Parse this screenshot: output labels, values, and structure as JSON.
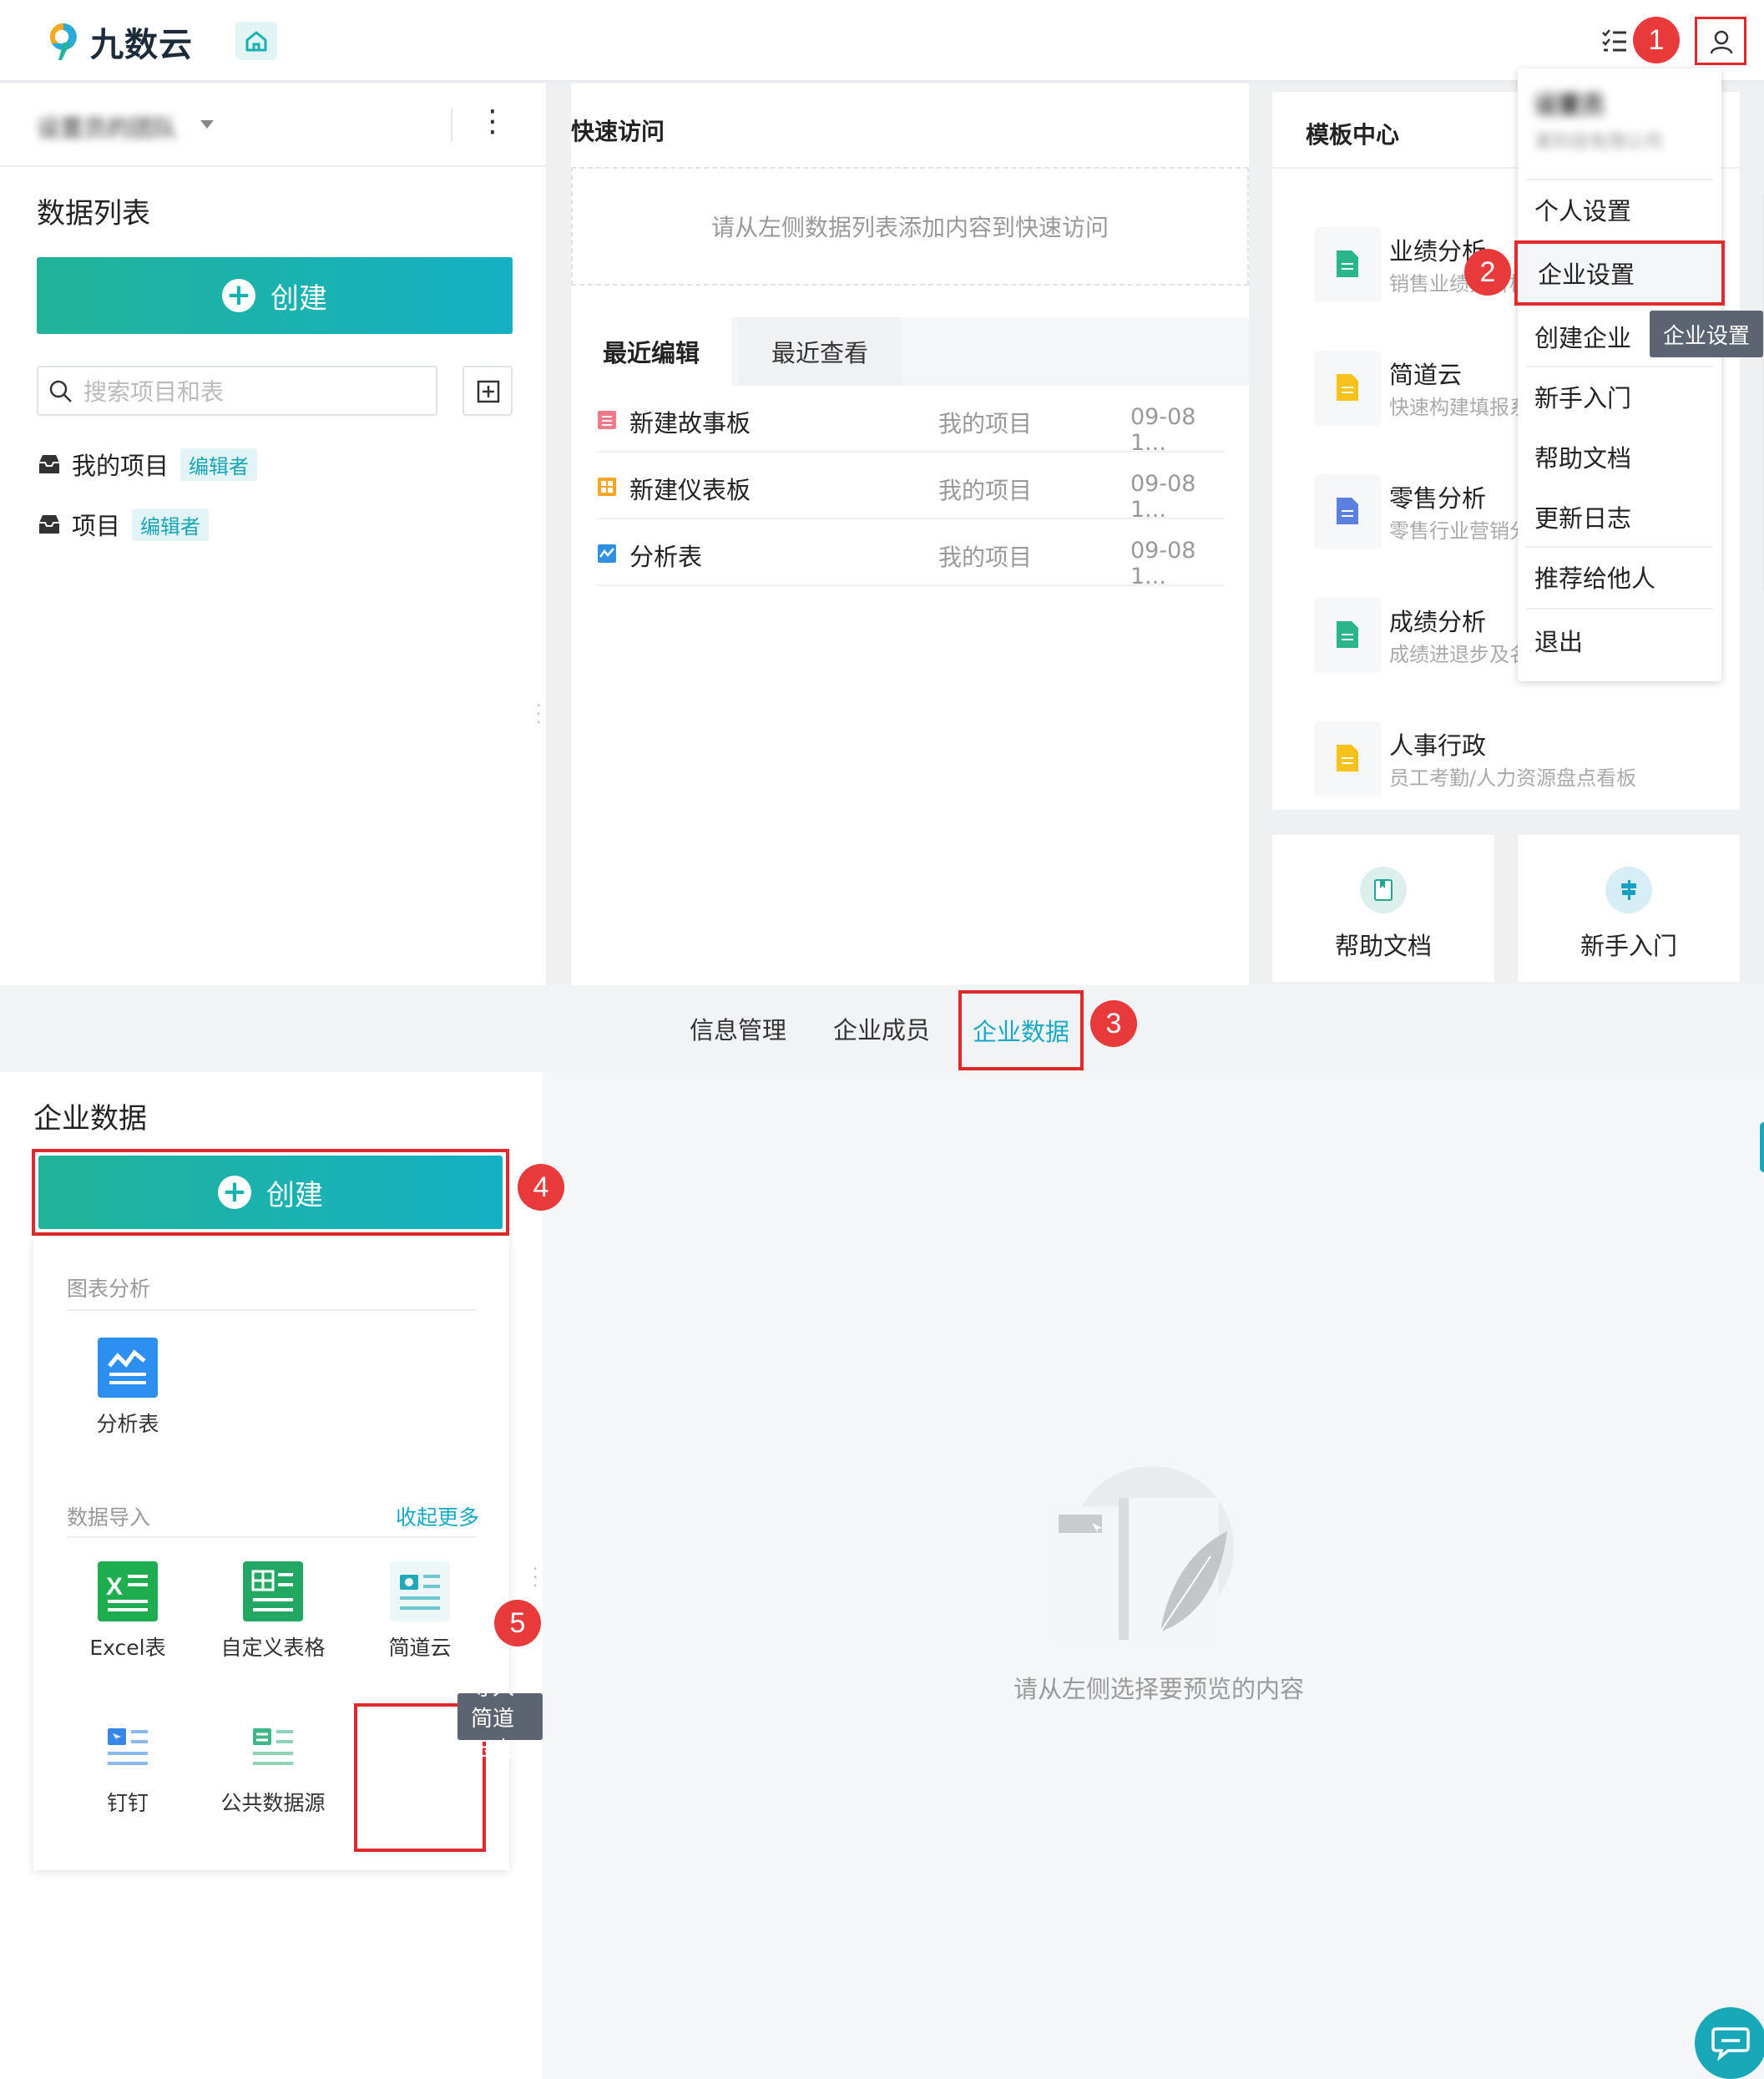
{
  "app": {
    "logo_text": "九数云",
    "brand_color": "#17b1b0",
    "annotation_color": "#e0292c"
  },
  "steps": [
    "1",
    "2",
    "3",
    "4",
    "5"
  ],
  "header": {
    "home_icon": "home-icon",
    "tasks_icon": "task-list-icon",
    "user_icon": "user-icon"
  },
  "left_panel": {
    "team_name": "设置员的团队",
    "title": "数据列表",
    "create_label": "创建",
    "search_placeholder": "搜索项目和表",
    "projects": [
      {
        "name": "我的项目",
        "tag": "编辑者"
      },
      {
        "name": "项目",
        "tag": "编辑者"
      }
    ]
  },
  "quick_access": {
    "title": "快速访问",
    "empty_hint": "请从左侧数据列表添加内容到快速访问"
  },
  "recent": {
    "tabs": [
      "最近编辑",
      "最近查看"
    ],
    "rows": [
      {
        "name": "新建故事板",
        "project": "我的项目",
        "date": "09-08 1..."
      },
      {
        "name": "新建仪表板",
        "project": "我的项目",
        "date": "09-08 1..."
      },
      {
        "name": "分析表",
        "project": "我的项目",
        "date": "09-08 1..."
      }
    ]
  },
  "template_center": {
    "title": "模板中心",
    "items": [
      {
        "name": "业绩分析",
        "desc": "销售业绩分析模板"
      },
      {
        "name": "简道云",
        "desc": "快速构建填报系统"
      },
      {
        "name": "零售分析",
        "desc": "零售行业营销分析"
      },
      {
        "name": "成绩分析",
        "desc": "成绩进退步及名次"
      },
      {
        "name": "人事行政",
        "desc": "员工考勤/人力资源盘点看板"
      }
    ],
    "shortcuts": [
      "帮助文档",
      "新手入门"
    ]
  },
  "user_menu": {
    "user_name": "设置员",
    "company": "某科技有限公司",
    "items": [
      "个人设置",
      "企业设置",
      "创建企业",
      "新手入门",
      "帮助文档",
      "更新日志",
      "推荐给他人",
      "退出"
    ],
    "tooltip": "企业设置"
  },
  "settings_tabs": [
    "信息管理",
    "企业成员",
    "企业数据"
  ],
  "enterprise_data": {
    "title": "企业数据",
    "create_label": "创建",
    "section_chart": "图表分析",
    "chart_items": [
      "分析表"
    ],
    "section_import": "数据导入",
    "collapse_label": "收起更多",
    "import_items": [
      "Excel表",
      "自定义表格",
      "简道云",
      "钉钉",
      "公共数据源"
    ],
    "tooltip": "导入简道云表",
    "empty_hint": "请从左侧选择要预览的内容"
  }
}
